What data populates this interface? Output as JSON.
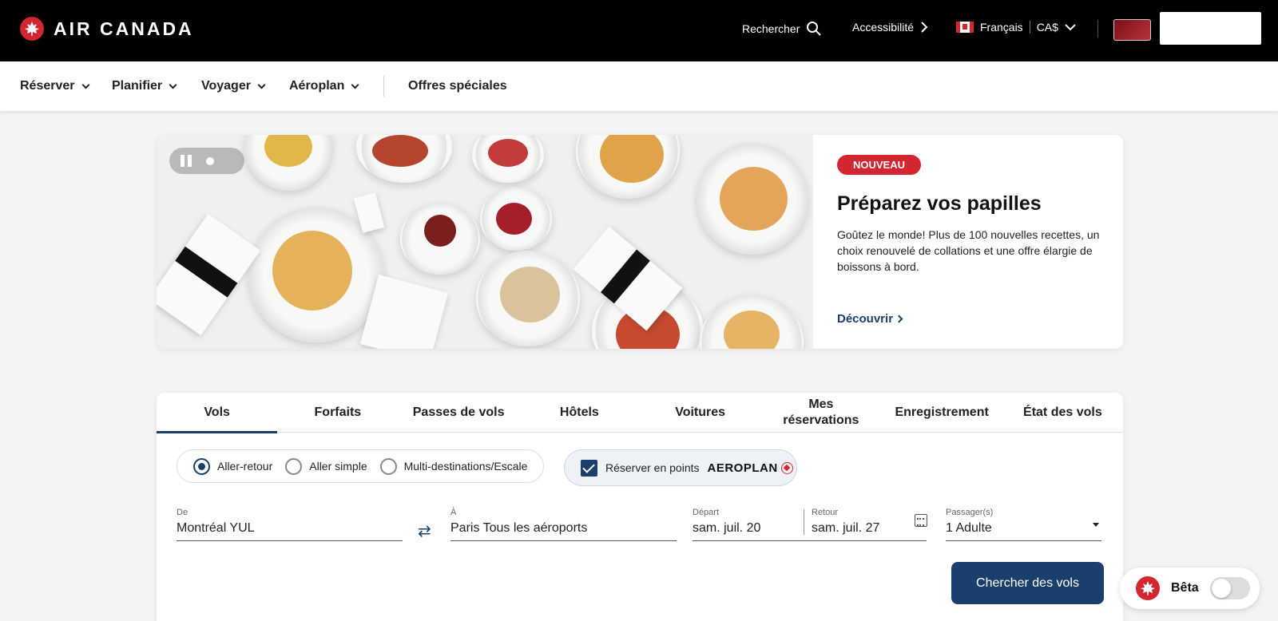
{
  "header": {
    "brand": "AIR CANADA",
    "search_label": "Rechercher",
    "accessibility_label": "Accessibilité",
    "language_label": "Français",
    "currency_label": "CA$"
  },
  "mainnav": {
    "items": [
      {
        "label": "Réserver"
      },
      {
        "label": "Planifier"
      },
      {
        "label": "Voyager"
      },
      {
        "label": "Aéroplan"
      }
    ],
    "special_offers": "Offres spéciales"
  },
  "hero": {
    "badge": "NOUVEAU",
    "title": "Préparez vos papilles",
    "description": "Goûtez le monde! Plus de 100 nouvelles recettes, un choix renouvelé de collations et une offre élargie de boissons à bord.",
    "link": "Découvrir"
  },
  "booking": {
    "tabs": [
      {
        "label": "Vols"
      },
      {
        "label": "Forfaits"
      },
      {
        "label": "Passes de vols"
      },
      {
        "label": "Hôtels"
      },
      {
        "label": "Voitures"
      },
      {
        "label": "Mes réservations"
      },
      {
        "label": "Enregistrement"
      },
      {
        "label": "État des vols"
      }
    ],
    "trip_types": [
      {
        "label": "Aller-retour"
      },
      {
        "label": "Aller simple"
      },
      {
        "label": "Multi-destinations/Escale"
      }
    ],
    "points_label": "Réserver en points",
    "aeroplan_logo": "AEROPLAN",
    "from": {
      "label": "De",
      "value": "Montréal YUL"
    },
    "to": {
      "label": "À",
      "value": "Paris Tous les aéroports"
    },
    "depart": {
      "label": "Départ",
      "value": "sam. juil. 20"
    },
    "return": {
      "label": "Retour",
      "value": "sam. juil. 27"
    },
    "passengers": {
      "label": "Passager(s)",
      "value": "1 Adulte"
    },
    "search_button": "Chercher des vols"
  },
  "beta": {
    "label": "Bêta"
  },
  "colors": {
    "brand_red": "#d22630",
    "navy": "#1b3f6c",
    "topbar": "#000000"
  }
}
